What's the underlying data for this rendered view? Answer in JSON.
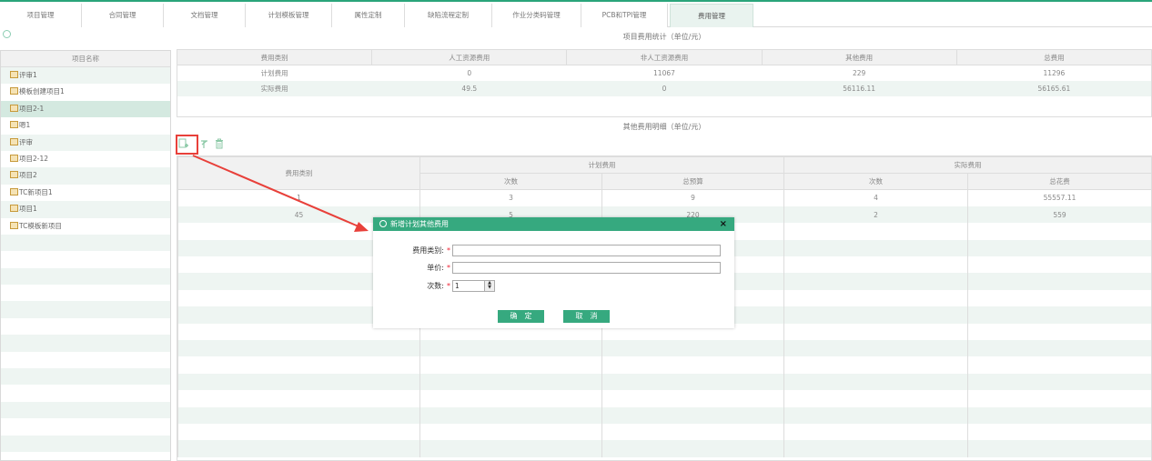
{
  "colors": {
    "accent": "#36a97f",
    "highlight": "#e8403a"
  },
  "tabs": [
    {
      "label": "项目管理"
    },
    {
      "label": "合同管理"
    },
    {
      "label": "文档管理"
    },
    {
      "label": "计划模板管理"
    },
    {
      "label": "属性定制"
    },
    {
      "label": "缺陷流程定制"
    },
    {
      "label": "作业分类码管理"
    },
    {
      "label": "PCB和TPI管理"
    },
    {
      "label": "费用管理",
      "active": true
    }
  ],
  "left_panel": {
    "header": "项目名称",
    "items": [
      {
        "label": "评审1"
      },
      {
        "label": "模板创建项目1"
      },
      {
        "label": "项目2-1",
        "selected": true
      },
      {
        "label": "嗯1"
      },
      {
        "label": "评审"
      },
      {
        "label": "项目2-12"
      },
      {
        "label": "项目2"
      },
      {
        "label": "TC新项目1"
      },
      {
        "label": "项目1"
      },
      {
        "label": "TC模板新项目"
      }
    ]
  },
  "summary": {
    "caption": "项目费用统计（单位/元）",
    "columns": [
      "费用类别",
      "人工资源费用",
      "非人工资源费用",
      "其他费用",
      "总费用"
    ],
    "rows": [
      [
        "计划费用",
        "0",
        "11067",
        "229",
        "11296"
      ],
      [
        "实际费用",
        "49.5",
        "0",
        "56116.11",
        "56165.61"
      ]
    ]
  },
  "other": {
    "caption": "其他费用明细（单位/元）",
    "toolbar_icons": [
      "add-icon",
      "edit-icon",
      "delete-icon"
    ],
    "col_category": "费用类别",
    "group_planned": "计划费用",
    "group_actual": "实际费用",
    "sub_columns": [
      "次数",
      "总预算",
      "次数",
      "总花费"
    ],
    "rows": [
      [
        "1",
        "3",
        "9",
        "4",
        "55557.11"
      ],
      [
        "45",
        "5",
        "220",
        "2",
        "559"
      ]
    ]
  },
  "dialog": {
    "title": "新增计划其他费用",
    "close": "×",
    "fields": {
      "category_label": "费用类别:",
      "unit_price_label": "单价:",
      "count_label": "次数:",
      "count_value": "1",
      "required_mark": "*"
    },
    "confirm": "确　定",
    "cancel": "取　消"
  }
}
